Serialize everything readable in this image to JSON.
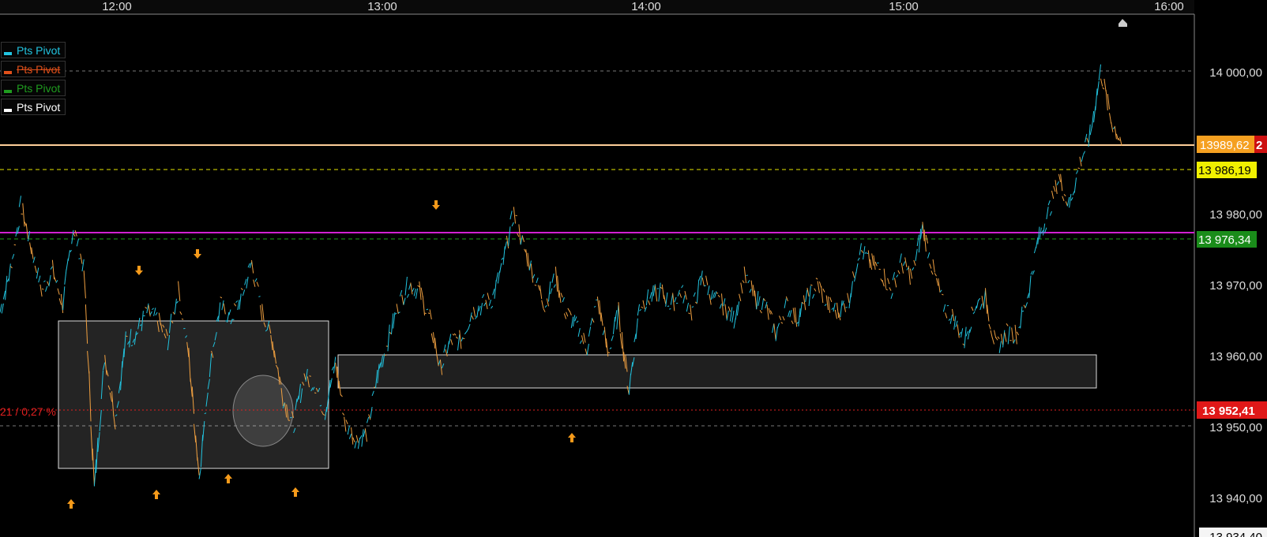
{
  "time_axis": {
    "labels": [
      "12:00",
      "13:00",
      "14:00",
      "15:00",
      "16:00"
    ]
  },
  "price_axis": {
    "labels": [
      "14 000,00",
      "13 980,00",
      "13 970,00",
      "13 960,00",
      "13 950,00",
      "13 940,00",
      "13 934,40"
    ]
  },
  "legend": [
    {
      "label": "Pts Pivot",
      "color": "#22c4e0"
    },
    {
      "label": "Pts Pivot",
      "color": "#e0501a"
    },
    {
      "label": "Pts Pivot",
      "color": "#1f9c1f"
    },
    {
      "label": "Pts Pivot",
      "color": "#ffffff"
    }
  ],
  "tags": {
    "last_price": "13989,62",
    "last_price_suffix": "2",
    "yellow_level": "13 986,19",
    "green_level": "13 976,34",
    "red_level": "13 952,41",
    "red_level_change": "21 / 0,27 %"
  },
  "colors": {
    "background": "#000000",
    "price_up": "#22c4e0",
    "price_down": "#f0a040",
    "arrow": "#f59a1a",
    "magenta_line": "#d020d0",
    "green_line": "#1fa01f",
    "yellow_line": "#e6e600",
    "red_line": "#e02020",
    "last_price_line": "#ffcf9a"
  },
  "chart_data": {
    "type": "line",
    "title": "",
    "x_ticks": [
      "12:00",
      "13:00",
      "14:00",
      "15:00",
      "16:00"
    ],
    "y_range": [
      13934.4,
      14006
    ],
    "levels": [
      {
        "name": "last",
        "value": 13989.62
      },
      {
        "name": "yellow",
        "value": 13986.19
      },
      {
        "name": "magenta",
        "value": 13977.1
      },
      {
        "name": "green",
        "value": 13976.34
      },
      {
        "name": "red",
        "value": 13952.41
      }
    ],
    "series": [
      {
        "values": [
          13966,
          13972,
          13981,
          13975,
          13969,
          13972,
          13967,
          13978,
          13972,
          13941,
          13960,
          13951,
          13962,
          13963,
          13966,
          13965,
          13962,
          13969,
          13960,
          13943,
          13958,
          13967,
          13965,
          13968,
          13973,
          13966,
          13962,
          13954,
          13950,
          13957,
          13956,
          13952,
          13959,
          13950,
          13948,
          13949,
          13957,
          13962,
          13967,
          13970,
          13969,
          13965,
          13958,
          13962,
          13962,
          13966,
          13967,
          13968,
          13973,
          13980,
          13975,
          13971,
          13967,
          13971,
          13966,
          13964,
          13961,
          13968,
          13960,
          13966,
          13955,
          13967,
          13968,
          13969,
          13967,
          13969,
          13966,
          13971,
          13968,
          13967,
          13965,
          13971,
          13968,
          13967,
          13963,
          13967,
          13965,
          13968,
          13970,
          13967,
          13966,
          13968,
          13975,
          13973,
          13972,
          13969,
          13973,
          13971,
          13978,
          13972,
          13967,
          13965,
          13962,
          13967,
          13968,
          13961,
          13963,
          13963,
          13968,
          13976,
          13980,
          13985,
          13981,
          13987,
          13991,
          14000,
          13993,
          13990
        ]
      }
    ]
  }
}
